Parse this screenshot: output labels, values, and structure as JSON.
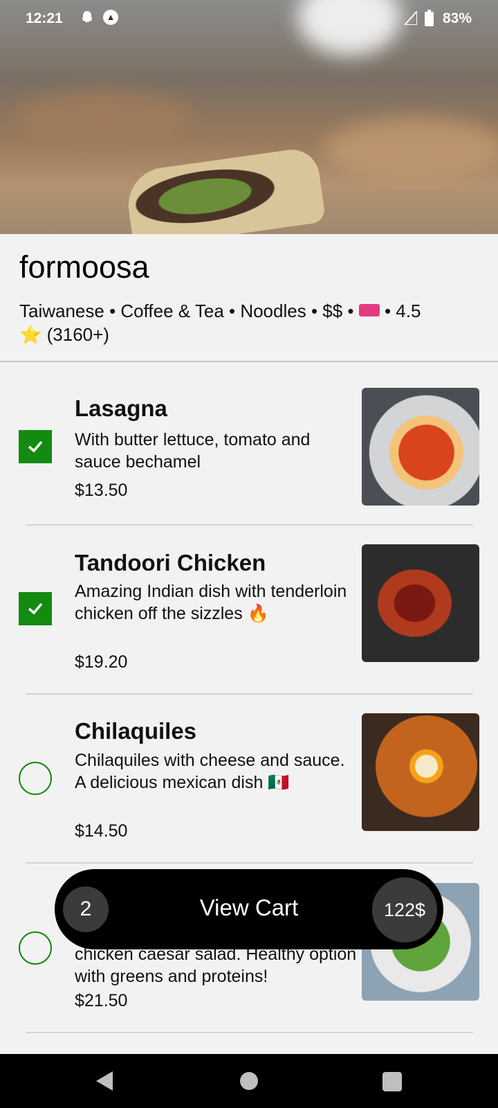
{
  "status_bar": {
    "time": "12:21",
    "battery_percent": "83%"
  },
  "restaurant": {
    "name": "formoosa",
    "meta_left": "Taiwanese • Coffee & Tea • Noodles  • $$ •",
    "meta_rating": "• 4.5",
    "star": "⭐",
    "reviews": "(3160+)"
  },
  "menu_items": [
    {
      "name": "Lasagna",
      "description": "With butter lettuce, tomato and sauce bechamel",
      "price": "$13.50",
      "selected": true
    },
    {
      "name": "Tandoori Chicken",
      "description": "Amazing Indian dish with tenderloin chicken off the sizzles 🔥",
      "price": "$19.20",
      "selected": true
    },
    {
      "name": "Chilaquiles",
      "description": "Chilaquiles with cheese and sauce. A delicious mexican dish 🇲🇽",
      "price": "$14.50",
      "selected": false
    },
    {
      "name": "",
      "description": "chicken caesar salad. Healthy option with greens and proteins!",
      "price": "$21.50",
      "selected": false
    }
  ],
  "cart": {
    "count": "2",
    "label": "View Cart",
    "total": "122$"
  },
  "colors": {
    "accent": "#138a10",
    "cart_background": "#000000",
    "ticket": "#e53980"
  },
  "icons": {
    "status": [
      "snapchat-ghost-icon",
      "navigation-icon",
      "signal-icon",
      "battery-icon"
    ],
    "navbar": [
      "back-icon",
      "home-icon",
      "recents-icon"
    ]
  }
}
